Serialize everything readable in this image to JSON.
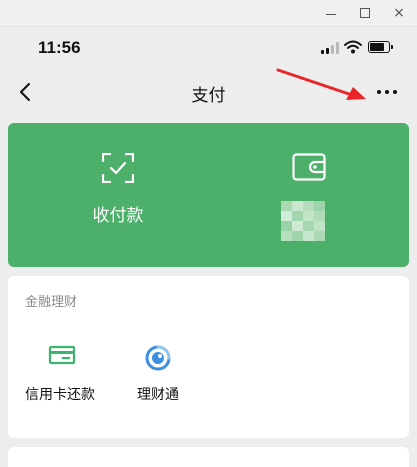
{
  "window": {
    "controls": [
      "minimize",
      "maximize",
      "close"
    ],
    "close_glyph": "×"
  },
  "status_bar": {
    "time": "11:56"
  },
  "nav": {
    "title": "支付",
    "back_icon": "chevron-left-icon",
    "more_icon": "more-dots-icon"
  },
  "pay_card": {
    "color": "#4caf6a",
    "items": [
      {
        "label": "收付款",
        "icon": "scan-check-icon"
      },
      {
        "label": "",
        "icon": "wallet-icon"
      }
    ]
  },
  "finance": {
    "title": "金融理财",
    "items": [
      {
        "label": "信用卡还款",
        "icon": "credit-card-icon",
        "color": "#3cb371"
      },
      {
        "label": "理财通",
        "icon": "licaitong-icon",
        "color": "#3d8fe0"
      }
    ]
  },
  "annotation": {
    "color": "#e8262a"
  }
}
